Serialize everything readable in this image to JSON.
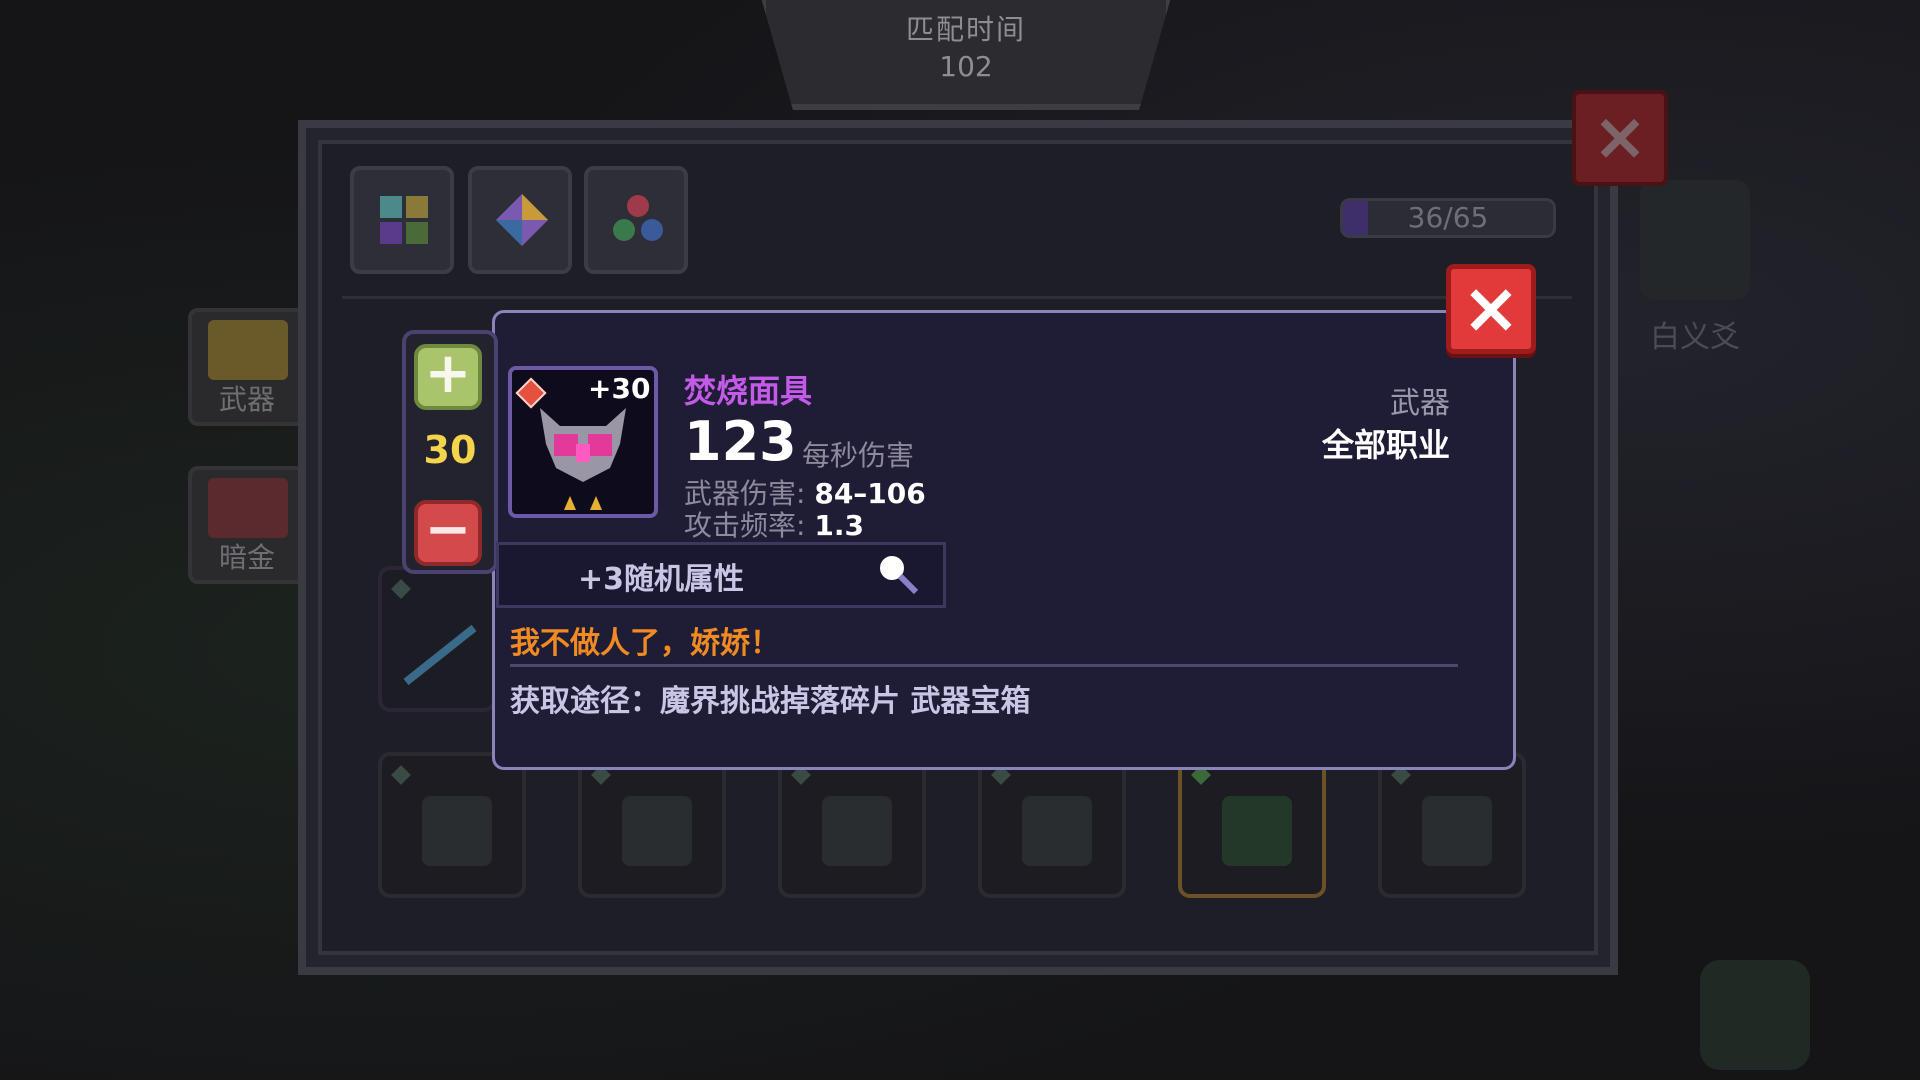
{
  "match": {
    "label": "匹配时间",
    "value": "102"
  },
  "panel": {
    "tabs": [
      "tab-grid",
      "tab-gem",
      "tab-orbs"
    ],
    "progress": {
      "text": "36/65",
      "fraction": 0.12
    }
  },
  "categories": [
    {
      "label": "武器",
      "color": "#6a5a2a"
    },
    {
      "label": "暗金",
      "color": "#5a2a2e"
    }
  ],
  "stepper": {
    "value": "30",
    "plus": "+",
    "minus": "−"
  },
  "item": {
    "name": "焚烧面具",
    "level": "+30",
    "dps": "123",
    "dps_label": "每秒伤害",
    "damage_label": "武器伤害:",
    "damage_value": "84–106",
    "rate_label": "攻击频率:",
    "rate_value": "1.3",
    "type": "武器",
    "class": "全部职业",
    "random_attrs": "+3随机属性",
    "quote": "我不做人了，娇娇！",
    "source": "获取途径：魔界挑战掉落碎片 武器宝箱"
  },
  "right": {
    "name": "白义爻"
  },
  "icons": {
    "panel_close": "close-icon",
    "card_close": "close-icon",
    "magnifier": "magnifier-icon"
  }
}
